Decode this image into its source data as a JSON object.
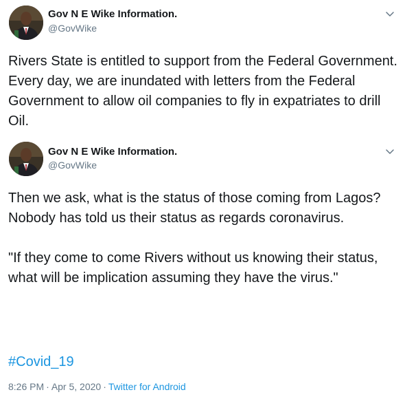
{
  "tweets": [
    {
      "display_name": "Gov N E Wike Information.",
      "handle": "@GovWike",
      "text": "Rivers State is entitled to support from the Federal Government.  Every day, we are inundated with letters from the Federal Government to allow oil companies to fly in expatriates to drill Oil."
    },
    {
      "display_name": "Gov N E Wike Information.",
      "handle": "@GovWike",
      "text": "Then we ask, what is the status of those coming from Lagos? Nobody has told us their status as regards coronavirus.\n\n\"If they come to come Rivers without us knowing their status, what will be implication assuming they have the virus.\"",
      "hashtag": "#Covid_19",
      "time": "8:26 PM",
      "separator": "·",
      "date": "Apr 5, 2020",
      "source": "Twitter for Android"
    }
  ],
  "icons": {
    "avatar": "profile-photo",
    "caret": "chevron-down-icon"
  },
  "colors": {
    "text": "#14171a",
    "secondary": "#657786",
    "link": "#1b95e0"
  }
}
